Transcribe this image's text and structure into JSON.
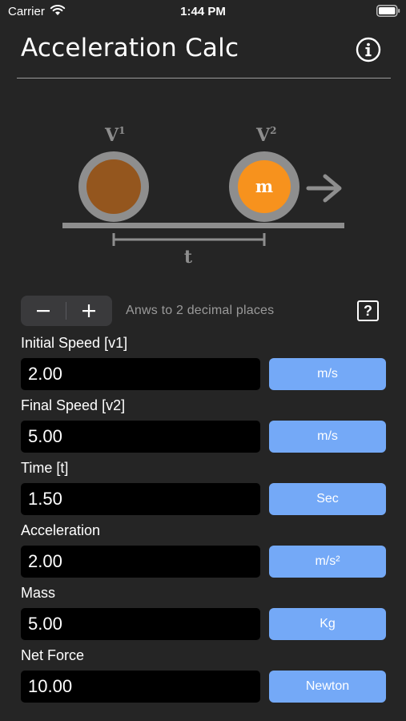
{
  "status_bar": {
    "carrier": "Carrier",
    "time": "1:44 PM"
  },
  "header": {
    "title": "Acceleration Calc",
    "info_icon": "info-circle-icon"
  },
  "diagram": {
    "v1_label": "V",
    "v1_sup": "1",
    "v2_label": "V",
    "v2_sup": "2",
    "mass_label": "m",
    "time_label": "t",
    "colors": {
      "ball_faded": "#94561e",
      "ball_active": "#f7921d",
      "ring": "#8e8e8e",
      "track": "#8e8e8e"
    }
  },
  "decimal_controls": {
    "minus_label": "−",
    "plus_label": "+",
    "note": "Anws to 2 decimal places",
    "help_label": "?"
  },
  "fields": [
    {
      "label": "Initial Speed [v1]",
      "value": "2.00",
      "unit": "m/s"
    },
    {
      "label": "Final Speed [v2]",
      "value": "5.00",
      "unit": "m/s"
    },
    {
      "label": "Time [t]",
      "value": "1.50",
      "unit": "Sec"
    },
    {
      "label": "Acceleration",
      "value": "2.00",
      "unit": "m/s²"
    },
    {
      "label": "Mass",
      "value": "5.00",
      "unit": "Kg"
    },
    {
      "label": "Net Force",
      "value": "10.00",
      "unit": "Newton"
    }
  ],
  "colors": {
    "background": "#252525",
    "unit_button": "#74a9f7",
    "input_background": "#000000"
  }
}
